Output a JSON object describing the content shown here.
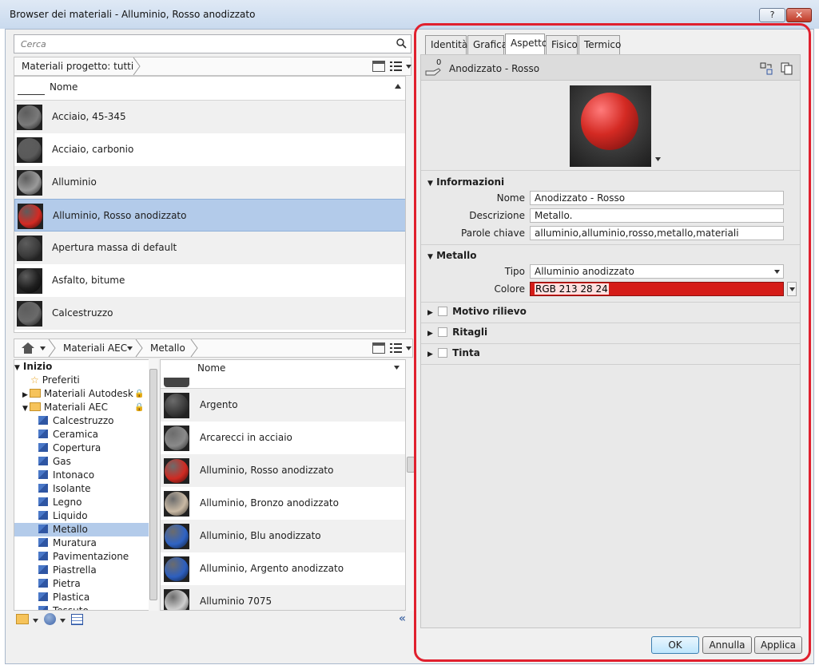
{
  "window": {
    "title": "Browser dei materiali - Alluminio, Rosso anodizzato",
    "help_label": "?",
    "close_label": "✕"
  },
  "search": {
    "placeholder": "Cerca"
  },
  "project_bar": {
    "label": "Materiali progetto: tutti"
  },
  "project_list": {
    "column_header": "Nome",
    "rows": [
      {
        "label": "Acciaio, 45-345",
        "thumb": "#7a7a7a"
      },
      {
        "label": "Acciaio, carbonio",
        "thumb": "#5a5a5a"
      },
      {
        "label": "Alluminio",
        "thumb": "#9a9a9a"
      },
      {
        "label": "Alluminio, Rosso anodizzato",
        "thumb": "#d42a23"
      },
      {
        "label": "Apertura massa di default",
        "thumb": "#3b3b3b"
      },
      {
        "label": "Asfalto, bitume",
        "thumb": "#1e1e1e"
      },
      {
        "label": "Calcestruzzo",
        "thumb": "#6a6a6a"
      }
    ]
  },
  "library_bar": {
    "crumb1": "Materiali AEC",
    "crumb2": "Metallo"
  },
  "tree": {
    "root": "Inizio",
    "favorites": "Preferiti",
    "autodesk": "Materiali Autodesk",
    "aec": "Materiali AEC",
    "categories": [
      "Calcestruzzo",
      "Ceramica",
      "Copertura",
      "Gas",
      "Intonaco",
      "Isolante",
      "Legno",
      "Liquido",
      "Metallo",
      "Muratura",
      "Pavimentazione",
      "Piastrella",
      "Pietra",
      "Plastica",
      "Tessuto"
    ],
    "selected": "Metallo"
  },
  "asset_list": {
    "column_header": "Nome",
    "rows": [
      {
        "label": "Argento",
        "thumb": "#3a3a3a"
      },
      {
        "label": "Arcarecci in acciaio",
        "thumb": "#8a8a8a"
      },
      {
        "label": "Alluminio, Rosso anodizzato",
        "thumb": "#cf2a22"
      },
      {
        "label": "Alluminio, Bronzo anodizzato",
        "thumb": "#c9b9a4"
      },
      {
        "label": "Alluminio, Blu anodizzato",
        "thumb": "#2f63c4"
      },
      {
        "label": "Alluminio, Argento anodizzato",
        "thumb": "#2d5fbf"
      },
      {
        "label": "Alluminio 7075",
        "thumb": "#cfcfcf"
      }
    ]
  },
  "tabs": [
    "Identità",
    "Grafica",
    "Aspetto",
    "Fisico",
    "Termico"
  ],
  "active_tab": "Aspetto",
  "asset": {
    "count": "0",
    "name": "Anodizzato - Rosso"
  },
  "info": {
    "title": "Informazioni",
    "name_label": "Nome",
    "name_value": "Anodizzato - Rosso",
    "desc_label": "Descrizione",
    "desc_value": "Metallo.",
    "keywords_label": "Parole chiave",
    "keywords_value": "alluminio,alluminio,rosso,metallo,materiali"
  },
  "metal": {
    "title": "Metallo",
    "type_label": "Tipo",
    "type_value": "Alluminio anodizzato",
    "color_label": "Colore",
    "color_value": "RGB 213 28 24",
    "color_hex": "#d51c18"
  },
  "sections": [
    "Motivo rilievo",
    "Ritagli",
    "Tinta"
  ],
  "buttons": {
    "ok": "OK",
    "cancel": "Annulla",
    "apply": "Applica"
  }
}
